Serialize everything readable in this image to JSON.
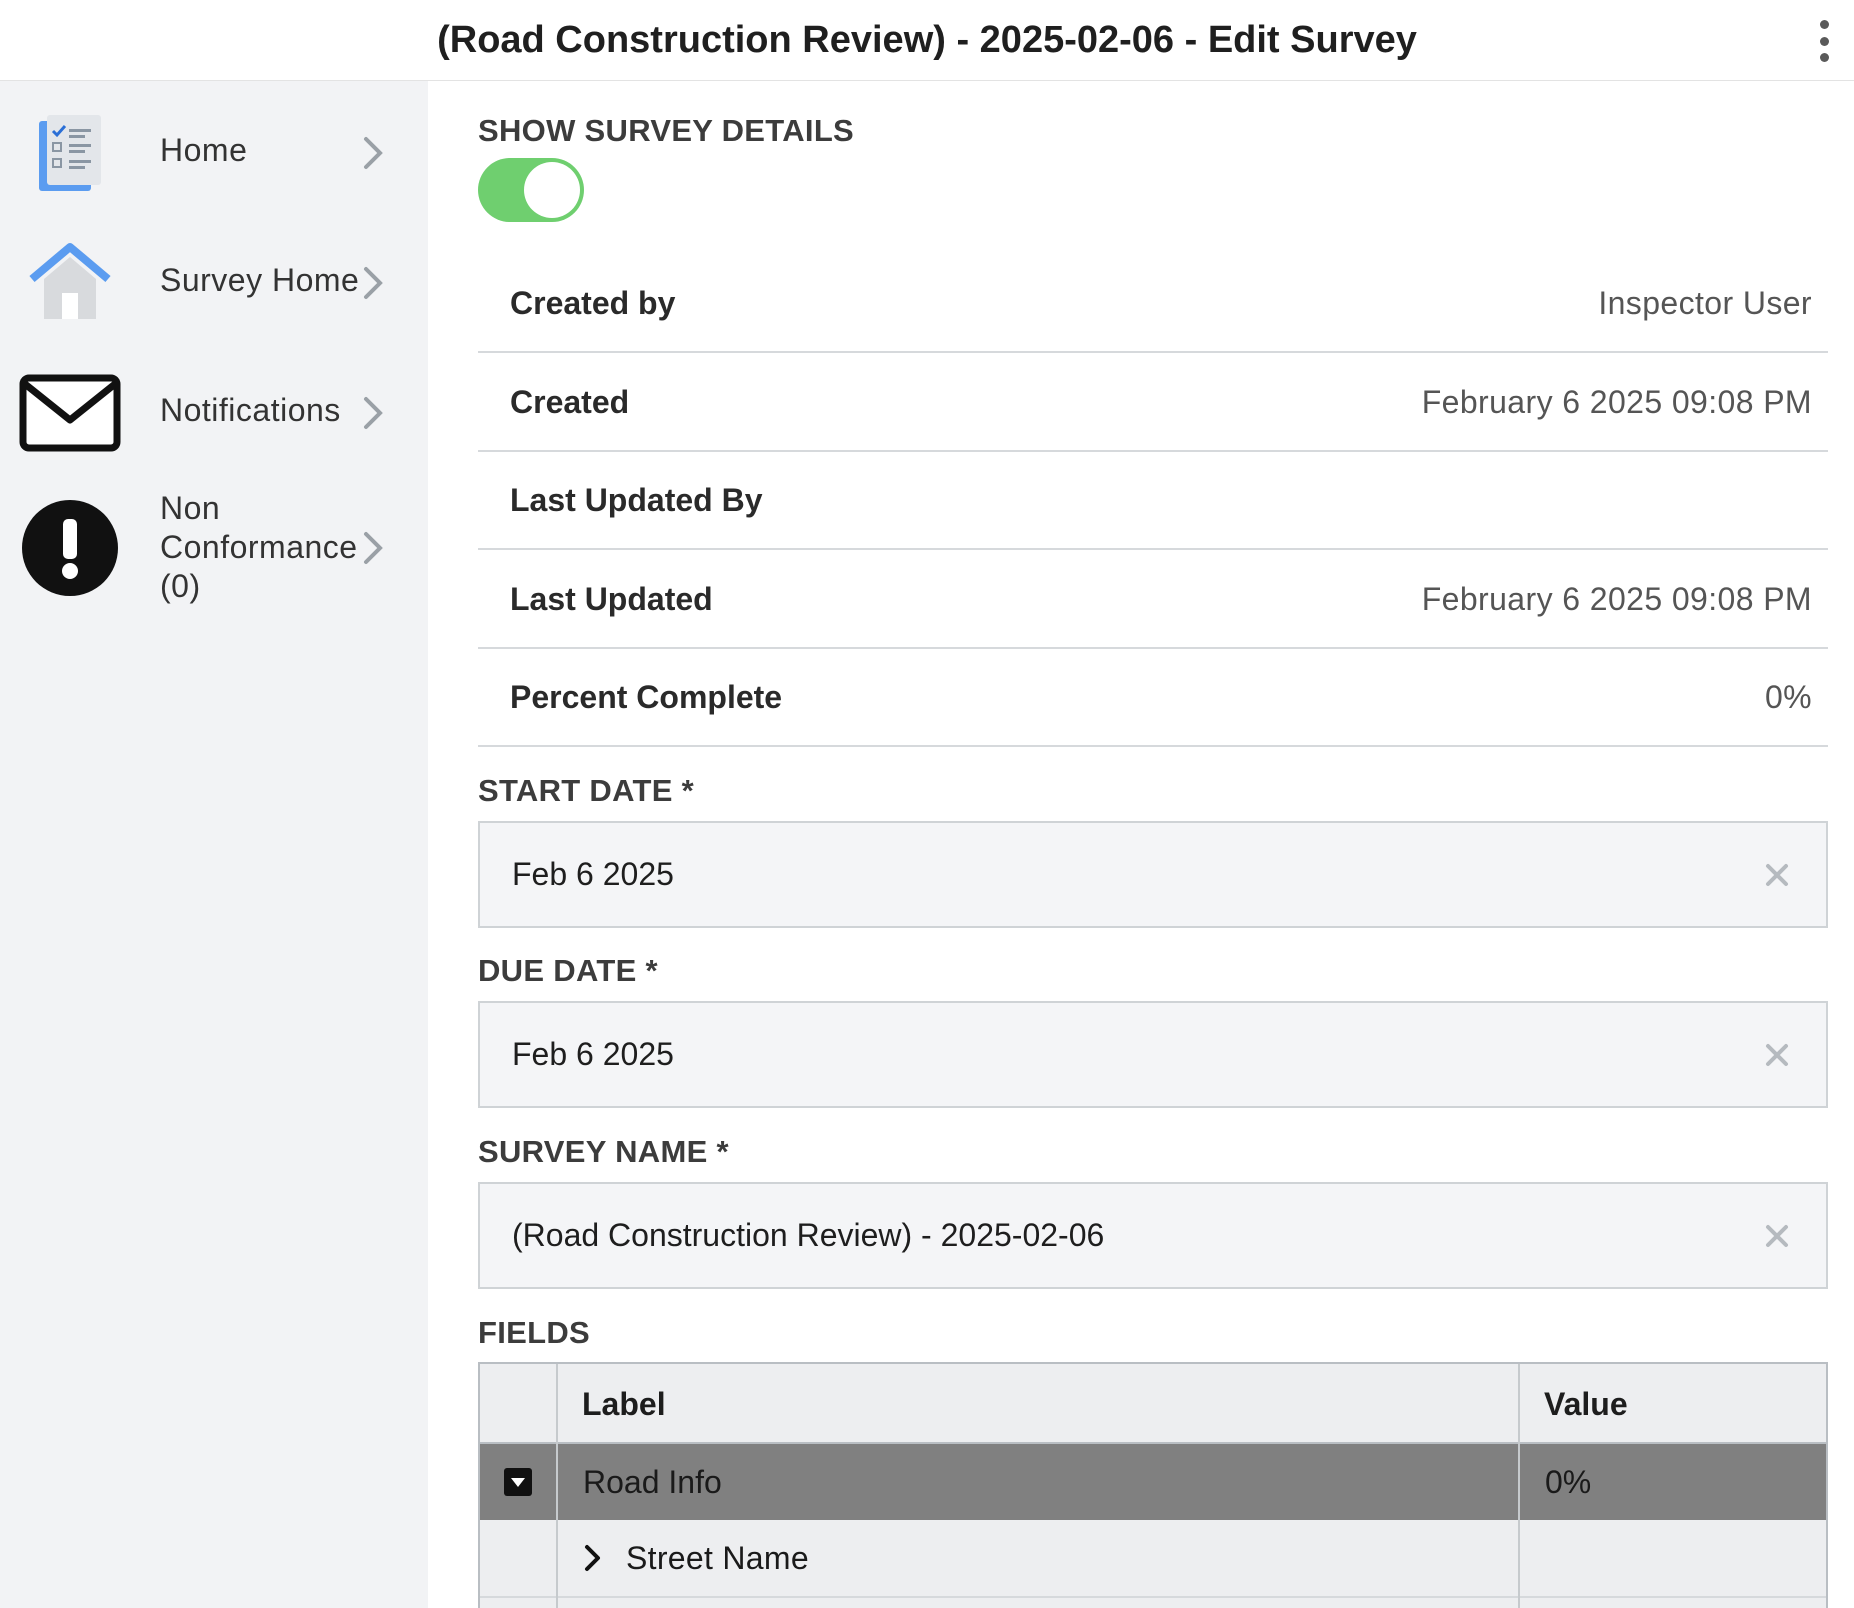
{
  "header": {
    "title": "(Road Construction Review) - 2025-02-06 - Edit Survey",
    "menu_icon": "kebab-menu-icon"
  },
  "sidebar": {
    "items": [
      {
        "label": "Home",
        "icon": "checklist-icon"
      },
      {
        "label": "Survey Home",
        "icon": "house-icon"
      },
      {
        "label": "Notifications",
        "icon": "envelope-icon"
      },
      {
        "label_lines": [
          "Non",
          "Conformance",
          "(0)"
        ],
        "icon": "exclamation-icon"
      }
    ]
  },
  "details": {
    "toggle_label": "SHOW SURVEY DETAILS",
    "toggle_on": true,
    "rows": [
      {
        "key": "Created by",
        "value": "Inspector User"
      },
      {
        "key": "Created",
        "value": "February 6 2025 09:08 PM"
      },
      {
        "key": "Last Updated By",
        "value": ""
      },
      {
        "key": "Last Updated",
        "value": "February 6 2025 09:08 PM"
      },
      {
        "key": "Percent Complete",
        "value": "0%"
      }
    ]
  },
  "form": {
    "start_date": {
      "label": "START DATE *",
      "value": "Feb 6 2025"
    },
    "due_date": {
      "label": "DUE DATE *",
      "value": "Feb 6 2025"
    },
    "survey_name": {
      "label": "SURVEY NAME *",
      "value": "(Road Construction Review) - 2025-02-06"
    }
  },
  "fields": {
    "label": "FIELDS",
    "columns": [
      "Label",
      "Value"
    ],
    "group": {
      "label": "Road Info",
      "value": "0%"
    },
    "child": {
      "label": "Street Name",
      "value": ""
    }
  },
  "colors": {
    "toggle_on": "#6fcf6f",
    "sidebar_bg": "#f2f3f5",
    "group_row_bg": "#808080",
    "accent_blue": "#5b9cf0"
  }
}
